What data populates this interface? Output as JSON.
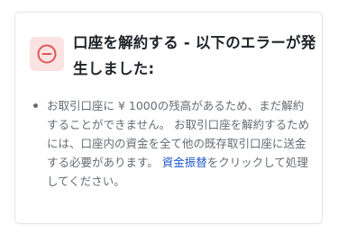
{
  "error": {
    "title": "口座を解約する - 以下のエラーが発生しました:",
    "icon": "minus-circle-icon",
    "colors": {
      "icon_stroke": "#e05757",
      "icon_background": "#fbe3e3",
      "link": "#1f5bc7"
    },
    "items": [
      {
        "text_before": "お取引口座に ¥ 1000の残高があるため、まだ解約することができません。 お取引口座を解約するためには、口座内の資金を全て他の既存取引口座に送金する必要があります。 ",
        "link_label": "資金振替",
        "text_after": "をクリックして処理してください。"
      }
    ]
  }
}
